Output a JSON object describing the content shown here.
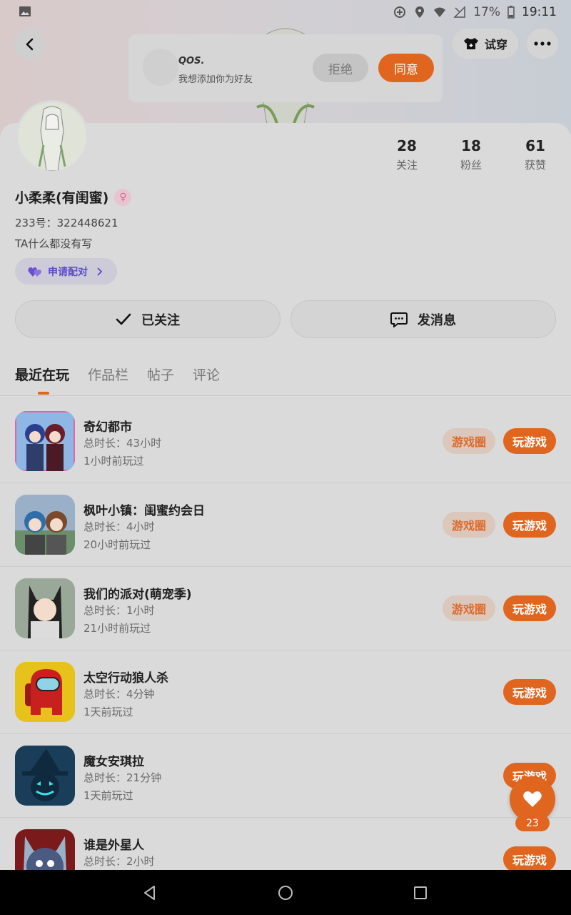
{
  "status_bar": {
    "battery": "17%",
    "time": "19:11"
  },
  "header": {
    "try_on_label": "试穿"
  },
  "friend_request": {
    "name": "QOS.",
    "message": "我想添加你为好友",
    "reject_label": "拒绝",
    "accept_label": "同意"
  },
  "profile": {
    "stats": [
      {
        "value": "28",
        "label": "关注"
      },
      {
        "value": "18",
        "label": "粉丝"
      },
      {
        "value": "61",
        "label": "获赞"
      }
    ],
    "nickname": "小柔柔(有闺蜜)",
    "uid": "233号：322448621",
    "bio": "TA什么都没有写",
    "pair_label": "申请配对",
    "followed_label": "已关注",
    "message_label": "发消息"
  },
  "tabs": [
    "最近在玩",
    "作品栏",
    "帖子",
    "评论"
  ],
  "games": [
    {
      "title": "奇幻都市",
      "duration": "总时长：43小时",
      "last_played": "1小时前玩过",
      "circle_label": "游戏圈",
      "play_label": "玩游戏"
    },
    {
      "title": "枫叶小镇：闺蜜约会日",
      "duration": "总时长：4小时",
      "last_played": "20小时前玩过",
      "circle_label": "游戏圈",
      "play_label": "玩游戏"
    },
    {
      "title": "我们的派对(萌宠季)",
      "duration": "总时长：1小时",
      "last_played": "21小时前玩过",
      "circle_label": "游戏圈",
      "play_label": "玩游戏"
    },
    {
      "title": "太空行动狼人杀",
      "duration": "总时长：4分钟",
      "last_played": "1天前玩过",
      "play_label": "玩游戏"
    },
    {
      "title": "魔女安琪拉",
      "duration": "总时长：21分钟",
      "last_played": "1天前玩过",
      "play_label": "玩游戏"
    },
    {
      "title": "谁是外星人",
      "duration": "总时长：2小时",
      "last_played": "",
      "play_label": "玩游戏"
    }
  ],
  "fab": {
    "count": "23"
  },
  "colors": {
    "accent": "#e0661f",
    "pair_accent": "#5b4fc4"
  }
}
